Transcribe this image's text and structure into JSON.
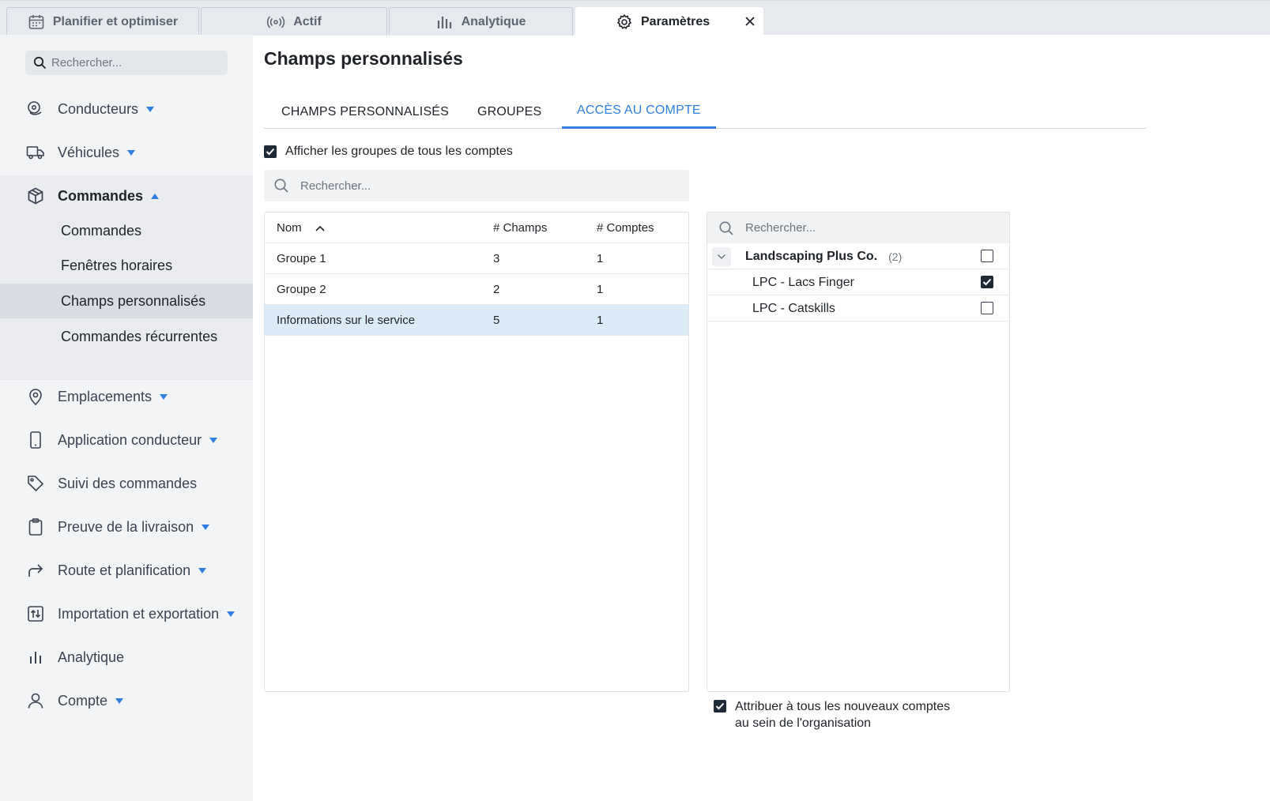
{
  "top_tabs": [
    {
      "label": "Planifier et optimiser",
      "icon": "calendar-icon"
    },
    {
      "label": "Actif",
      "icon": "broadcast-icon"
    },
    {
      "label": "Analytique",
      "icon": "bar-chart-icon"
    },
    {
      "label": "Paramètres",
      "icon": "gear-icon",
      "active": true
    }
  ],
  "sidebar": {
    "search_placeholder": "Rechercher...",
    "items": [
      {
        "label": "Conducteurs",
        "icon": "driver-icon",
        "has_caret": true
      },
      {
        "label": "Véhicules",
        "icon": "truck-icon",
        "has_caret": true
      },
      {
        "label": "Commandes",
        "icon": "box-icon",
        "expanded": true
      },
      {
        "label": "Emplacements",
        "icon": "map-pin-icon",
        "has_caret": true
      },
      {
        "label": "Application conducteur",
        "icon": "phone-icon",
        "has_caret": true
      },
      {
        "label": "Suivi des commandes",
        "icon": "tag-icon"
      },
      {
        "label": "Preuve de la livraison",
        "icon": "clipboard-icon",
        "has_caret": true
      },
      {
        "label": "Route et planification",
        "icon": "route-arrow-icon",
        "has_caret": true
      },
      {
        "label": "Importation et exportation",
        "icon": "import-export-icon",
        "has_caret": true
      },
      {
        "label": "Analytique",
        "icon": "bar-chart-icon"
      },
      {
        "label": "Compte",
        "icon": "user-icon",
        "has_caret": true
      }
    ],
    "sub_items": [
      {
        "label": "Commandes"
      },
      {
        "label": "Fenêtres horaires"
      },
      {
        "label": "Champs personnalisés",
        "selected": true
      },
      {
        "label": "Commandes récurrentes"
      }
    ]
  },
  "main": {
    "title": "Champs personnalisés",
    "tabs": [
      {
        "label": "CHAMPS PERSONNALISÉS"
      },
      {
        "label": "GROUPES"
      },
      {
        "label": "ACCÈS AU COMPTE",
        "active": true
      }
    ],
    "show_all_label": "Afficher les groupes de tous les comptes",
    "search_placeholder": "Rechercher...",
    "table": {
      "columns": [
        "Nom",
        "# Champs",
        "# Comptes"
      ],
      "rows": [
        {
          "name": "Groupe 1",
          "fields": "3",
          "accounts": "1"
        },
        {
          "name": "Groupe 2",
          "fields": "2",
          "accounts": "1"
        },
        {
          "name": "Informations sur le service",
          "fields": "5",
          "accounts": "1",
          "selected": true
        }
      ]
    },
    "accounts": {
      "search_placeholder": "Rechercher...",
      "org": {
        "name": "Landscaping Plus Co.",
        "count": "(2)",
        "checked": false
      },
      "items": [
        {
          "name": "LPC - Lacs Finger",
          "checked": true
        },
        {
          "name": "LPC - Catskills",
          "checked": false
        }
      ]
    },
    "assign_label_line1": "Attribuer à tous les nouveaux comptes",
    "assign_label_line2": "au sein de l'organisation"
  },
  "colors": {
    "accent": "#2f7ee0",
    "selected_row": "#dcecf7",
    "sidebar_bg": "#f3f4f6"
  }
}
